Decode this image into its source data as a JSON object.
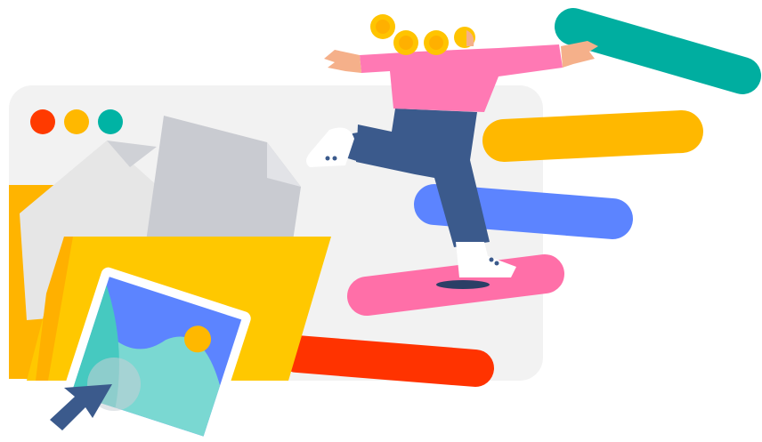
{
  "illustration": {
    "kind": "file-upload-illustration",
    "window_dots": [
      "red",
      "yellow",
      "teal"
    ],
    "colors": {
      "window_bg": "#f2f2f2",
      "dot_red": "#ff3a00",
      "dot_yellow": "#ffb800",
      "dot_teal": "#00b3a4",
      "folder_back": "#ffb400",
      "folder_front": "#ffc800",
      "paper_gray": "#c9cbd1",
      "paper_light": "#e8e8e8",
      "bar_teal": "#00aea0",
      "bar_yellow": "#ffb800",
      "bar_blue": "#5c84ff",
      "bar_pink": "#ff6fa8",
      "bar_red": "#ff3300",
      "shirt_pink": "#ff79b4",
      "pants_navy": "#3b5a8c",
      "coin_gold": "#ffc400",
      "photo_teal": "#46c9c0",
      "photo_blue": "#5c84ff",
      "sun_yellow": "#ffb800",
      "cursor_navy": "#3b5a8c"
    },
    "icons": [
      "image-icon",
      "cursor-arrow-icon",
      "folder-icon",
      "document-icon"
    ]
  }
}
